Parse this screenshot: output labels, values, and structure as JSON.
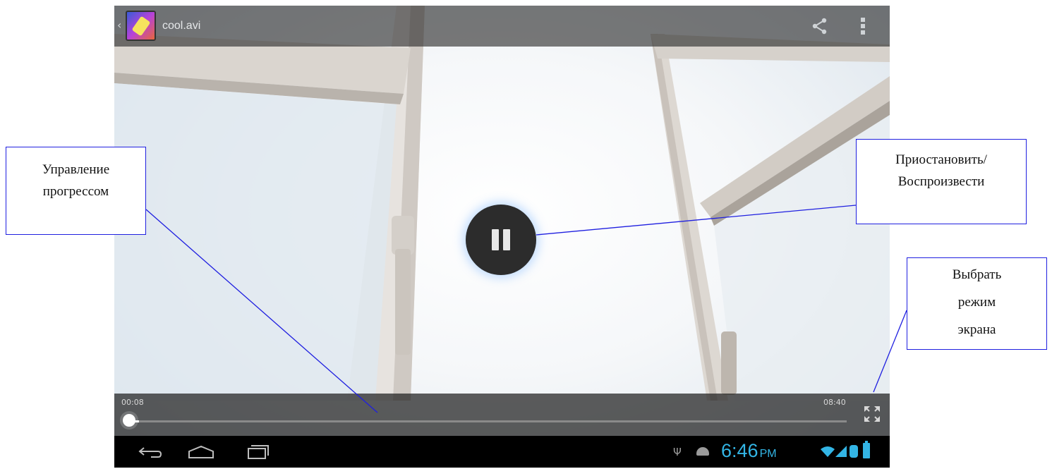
{
  "action_bar": {
    "back_icon": "chevron-left-icon",
    "app_icon": "gallery-icon",
    "title": "cool.avi",
    "share_icon": "share-icon",
    "overflow_icon": "overflow-menu-icon"
  },
  "player": {
    "state_icon": "pause-icon",
    "time_current": "00:08",
    "time_total": "08:40",
    "progress_fraction": 0.015,
    "fullscreen_icon": "fullscreen-toggle-icon"
  },
  "nav_bar": {
    "back_icon": "back-icon",
    "home_icon": "home-icon",
    "recent_icon": "recent-apps-icon"
  },
  "status_bar": {
    "usb_icon": "usb-icon",
    "android_icon": "android-debug-icon",
    "clock_time": "6:46",
    "clock_ampm": "PM",
    "wifi_icon": "wifi-icon",
    "signal_icon": "signal-icon",
    "bluetooth_icon": "bluetooth-icon",
    "battery_icon": "battery-icon",
    "accent_color": "#33b5e5"
  },
  "annotations": {
    "progress": {
      "line1": "Управление",
      "line2": "прогрессом"
    },
    "pause_play": {
      "line1": "Приостановить/",
      "line2": "Воспроизвести"
    },
    "screen_mode": {
      "line1": "Выбрать",
      "line2": "режим",
      "line3": "экрана"
    },
    "border_color": "#1f1fe0"
  }
}
